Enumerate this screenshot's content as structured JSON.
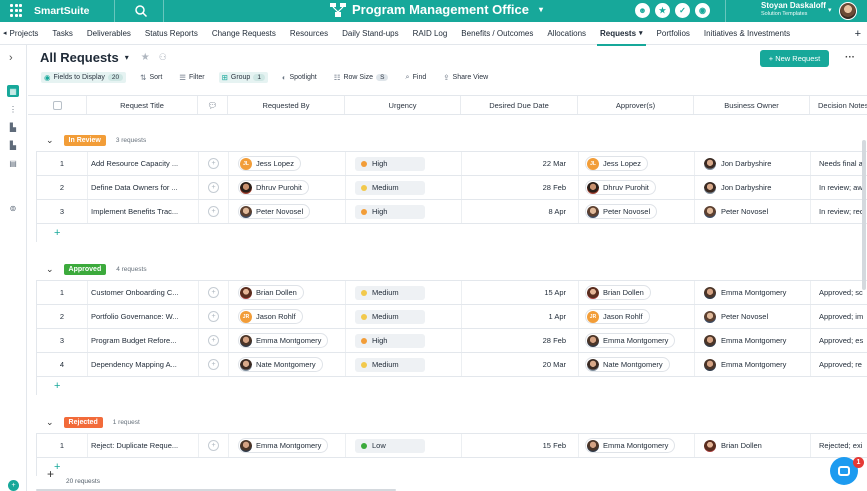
{
  "app": {
    "brand": "SmartSuite",
    "workspace_title": "Program Management Office",
    "user_name": "Stoyan Daskaloff",
    "user_org": "Solution Templates",
    "top_icons": [
      "team-icon",
      "star-icon",
      "check-icon",
      "bell-icon"
    ]
  },
  "tabs": {
    "items": [
      {
        "label": "Projects"
      },
      {
        "label": "Tasks"
      },
      {
        "label": "Deliverables"
      },
      {
        "label": "Status Reports"
      },
      {
        "label": "Change Requests"
      },
      {
        "label": "Resources"
      },
      {
        "label": "Daily Stand-ups"
      },
      {
        "label": "RAID Log"
      },
      {
        "label": "Benefits / Outcomes"
      },
      {
        "label": "Allocations"
      },
      {
        "label": "Requests"
      },
      {
        "label": "Portfolios"
      },
      {
        "label": "Initiatives & Investments"
      }
    ],
    "active": "Requests",
    "add": "+"
  },
  "view": {
    "title": "All Requests",
    "new_button": "+ New Request",
    "more": "···"
  },
  "toolbar": {
    "fields_label": "Fields to Display",
    "fields_count": "20",
    "sort": "Sort",
    "filter": "Filter",
    "group": "Group",
    "group_count": "1",
    "spotlight": "Spotlight",
    "row_size": "Row Size",
    "row_size_count": "S",
    "find": "Find",
    "share_view": "Share View"
  },
  "columns": {
    "title": "Request Title",
    "requested_by": "Requested By",
    "urgency": "Urgency",
    "due_date": "Desired Due Date",
    "approvers": "Approver(s)",
    "business_owner": "Business Owner",
    "decision_notes": "Decision Notes"
  },
  "colors": {
    "accent": "#17a89a",
    "in_review": "#f29d38",
    "approved": "#3caa3c",
    "rejected": "#f26b3a",
    "high": "#f29d38",
    "medium": "#f2c94c",
    "low": "#3caa3c"
  },
  "groups": [
    {
      "label": "In Review",
      "count": "3 requests",
      "color": "#f29d38",
      "rows": [
        {
          "num": "1",
          "title": "Add Resource Capacity ...",
          "requested_by": "Jess Lopez",
          "req_av": "JL",
          "urgency": "High",
          "due": "22 Mar",
          "approver": "Jess Lopez",
          "appr_av": "JL",
          "owner": "Jon Darbyshire",
          "notes": "Needs final a"
        },
        {
          "num": "2",
          "title": "Define Data Owners for ...",
          "requested_by": "Dhruv Purohit",
          "req_av": "",
          "urgency": "Medium",
          "due": "28 Feb",
          "approver": "Dhruv Purohit",
          "appr_av": "",
          "owner": "Jon Darbyshire",
          "notes": "In review; aw"
        },
        {
          "num": "3",
          "title": "Implement Benefits Trac...",
          "requested_by": "Peter Novosel",
          "req_av": "",
          "urgency": "High",
          "due": "8 Apr",
          "approver": "Peter Novosel",
          "appr_av": "",
          "owner": "Peter Novosel",
          "notes": "In review; red"
        }
      ]
    },
    {
      "label": "Approved",
      "count": "4 requests",
      "color": "#3caa3c",
      "rows": [
        {
          "num": "1",
          "title": "Customer Onboarding C...",
          "requested_by": "Brian Dollen",
          "req_av": "",
          "urgency": "Medium",
          "due": "15 Apr",
          "approver": "Brian Dollen",
          "appr_av": "",
          "owner": "Emma Montgomery",
          "notes": "Approved; sc"
        },
        {
          "num": "2",
          "title": "Portfolio Governance: W...",
          "requested_by": "Jason Rohlf",
          "req_av": "JR",
          "urgency": "Medium",
          "due": "1 Apr",
          "approver": "Jason Rohlf",
          "appr_av": "JR",
          "owner": "Peter Novosel",
          "notes": "Approved; im"
        },
        {
          "num": "3",
          "title": "Program Budget Refore...",
          "requested_by": "Emma Montgomery",
          "req_av": "",
          "urgency": "High",
          "due": "28 Feb",
          "approver": "Emma Montgomery",
          "appr_av": "",
          "owner": "Emma Montgomery",
          "notes": "Approved; es"
        },
        {
          "num": "4",
          "title": "Dependency Mapping A...",
          "requested_by": "Nate Montgomery",
          "req_av": "",
          "urgency": "Medium",
          "due": "20 Mar",
          "approver": "Nate Montgomery",
          "appr_av": "",
          "owner": "Emma Montgomery",
          "notes": "Approved; re"
        }
      ]
    },
    {
      "label": "Rejected",
      "count": "1 request",
      "color": "#f26b3a",
      "rows": [
        {
          "num": "1",
          "title": "Reject: Duplicate Reque...",
          "requested_by": "Emma Montgomery",
          "req_av": "",
          "urgency": "Low",
          "due": "15 Feb",
          "approver": "Emma Montgomery",
          "appr_av": "",
          "owner": "Brian Dollen",
          "notes": "Rejected; exi"
        }
      ]
    }
  ],
  "footer": {
    "add": "+",
    "total": "20 requests"
  },
  "chat": {
    "badge": "1"
  }
}
